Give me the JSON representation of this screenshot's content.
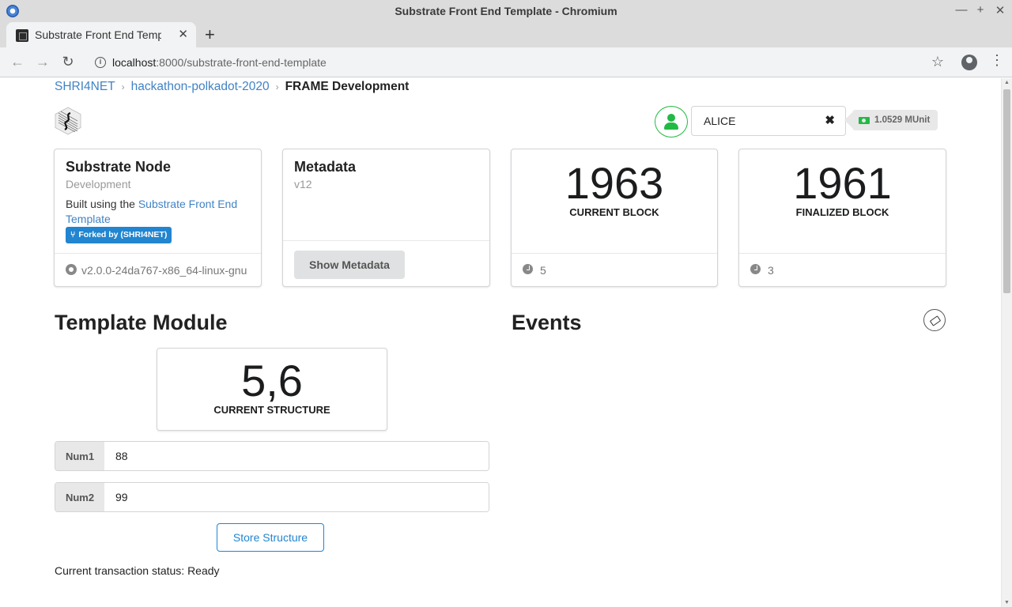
{
  "window": {
    "title": "Substrate Front End Template - Chromium"
  },
  "tab": {
    "title": "Substrate Front End Template"
  },
  "address": {
    "host": "localhost",
    "path": ":8000/substrate-front-end-template"
  },
  "breadcrumb": {
    "items": [
      "SHRI4NET",
      "hackathon-polkadot-2020"
    ],
    "active": "FRAME Development"
  },
  "account": {
    "name": "ALICE",
    "balance": "1.0529 MUnit"
  },
  "node_card": {
    "title": "Substrate Node",
    "meta": "Development",
    "desc_prefix": "Built using the ",
    "desc_link": "Substrate Front End Template",
    "fork_label": "Forked by (SHRI4NET)",
    "version": "v2.0.0-24da767-x86_64-linux-gnu"
  },
  "metadata_card": {
    "title": "Metadata",
    "meta": "v12",
    "button": "Show Metadata"
  },
  "current_block": {
    "value": "1963",
    "label": "Current Block",
    "timer": "5"
  },
  "finalized_block": {
    "value": "1961",
    "label": "Finalized Block",
    "timer": "3"
  },
  "template_module": {
    "title": "Template Module",
    "structure_value": "5,6",
    "structure_label": "Current Structure",
    "num1_label": "Num1",
    "num1_value": "88",
    "num2_label": "Num2",
    "num2_value": "99",
    "store_button": "Store Structure",
    "status": "Current transaction status: Ready"
  },
  "events": {
    "title": "Events"
  },
  "colors": {
    "link": "#4183c4",
    "primary": "#2185d0",
    "green": "#21ba45"
  }
}
